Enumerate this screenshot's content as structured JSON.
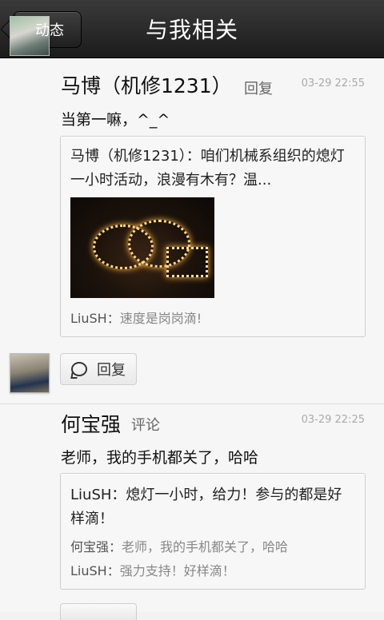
{
  "header": {
    "back_label": "动态",
    "title": "与我相关"
  },
  "items": [
    {
      "name": "马博（机修1231）",
      "action": "回复",
      "time": "03-29 22:55",
      "text": "当第一嘛，^_^",
      "quote": {
        "text": "马博（机修1231）：咱们机械系组织的熄灯一小时活动，浪漫有木有？温...",
        "comments": [
          {
            "who": "LiuSH：",
            "msg": "速度是岗岗滴!"
          }
        ]
      },
      "reply_label": "回复"
    },
    {
      "name": "何宝强",
      "action": "评论",
      "time": "03-29 22:25",
      "text": "老师，我的手机都关了，哈哈",
      "quote": {
        "text": "LiuSH：熄灯一小时，给力！参与的都是好样滴！",
        "comments": [
          {
            "who": "何宝强：",
            "msg": "老师，我的手机都关了，哈哈"
          },
          {
            "who": "LiuSH：",
            "msg": "强力支持！好样滴！"
          }
        ]
      }
    }
  ]
}
